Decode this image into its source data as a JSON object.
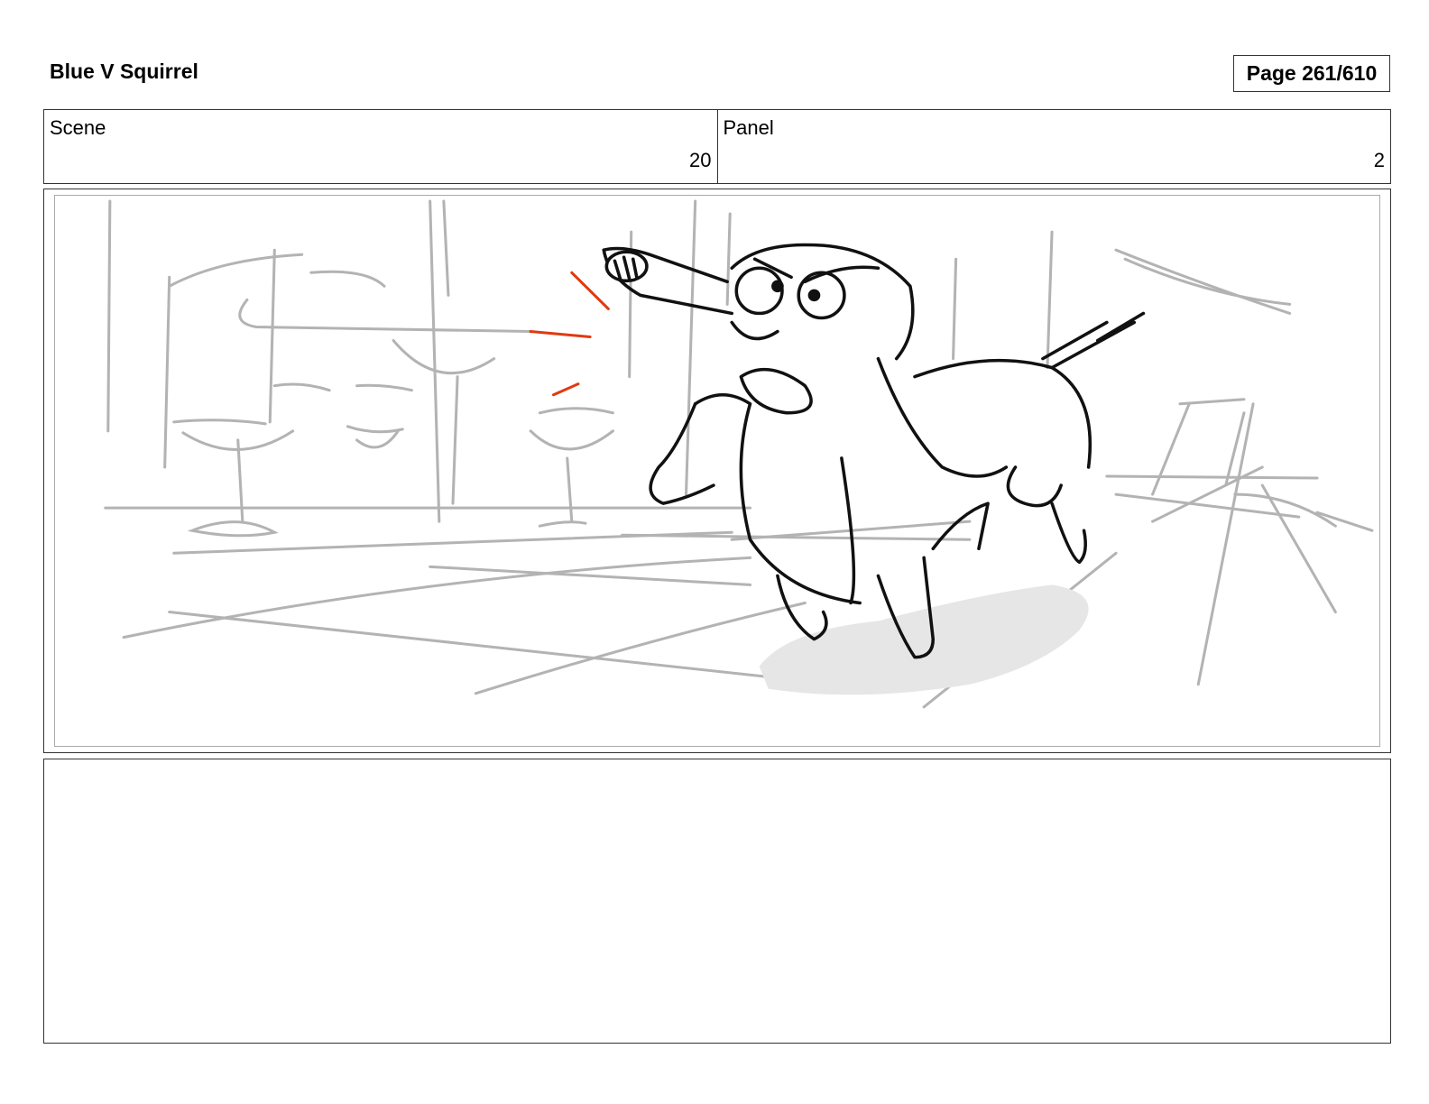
{
  "header": {
    "title": "Blue V Squirrel",
    "page": "Page 261/610"
  },
  "info": {
    "scene_label": "Scene",
    "scene_value": "20",
    "panel_label": "Panel",
    "panel_value": "2"
  },
  "artwork": {
    "description_icon": "storyboard-sketch",
    "line_color": "#000000",
    "background_color": "#aaaaaa",
    "accent_color": "#e03a10"
  },
  "notes": {
    "text": ""
  }
}
